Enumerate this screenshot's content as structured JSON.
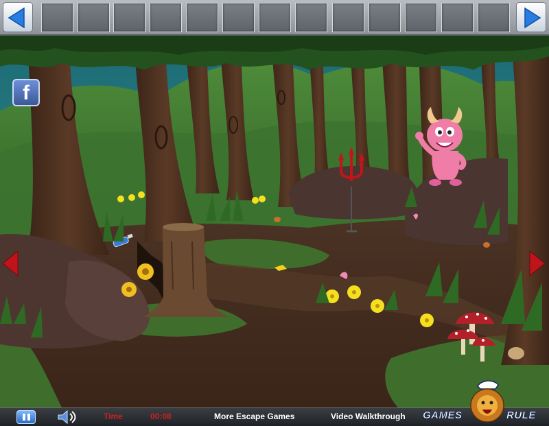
{
  "toolbar": {
    "prev_icon": "left-arrow-icon",
    "next_icon": "right-arrow-icon",
    "inventory_slot_count": 13
  },
  "social": {
    "facebook_label": "f"
  },
  "scene": {
    "left_nav_icon": "red-left-arrow-icon",
    "right_nav_icon": "red-right-arrow-icon",
    "objects": [
      "pink-monster",
      "red-trident",
      "blue-bottle",
      "tree-stump",
      "red-mushrooms",
      "yellow-flowers",
      "mushroom-cap"
    ]
  },
  "bottombar": {
    "time_label": "Time",
    "time_value": "00:08",
    "more_games_label": "More Escape Games",
    "walkthrough_label": "Video Walkthrough"
  },
  "logo": {
    "part1": "GAMES",
    "part2": "RULE"
  },
  "colors": {
    "accent_blue": "#2b6cc4",
    "nav_red": "#c0141c",
    "timer_red": "#d21f1f"
  }
}
